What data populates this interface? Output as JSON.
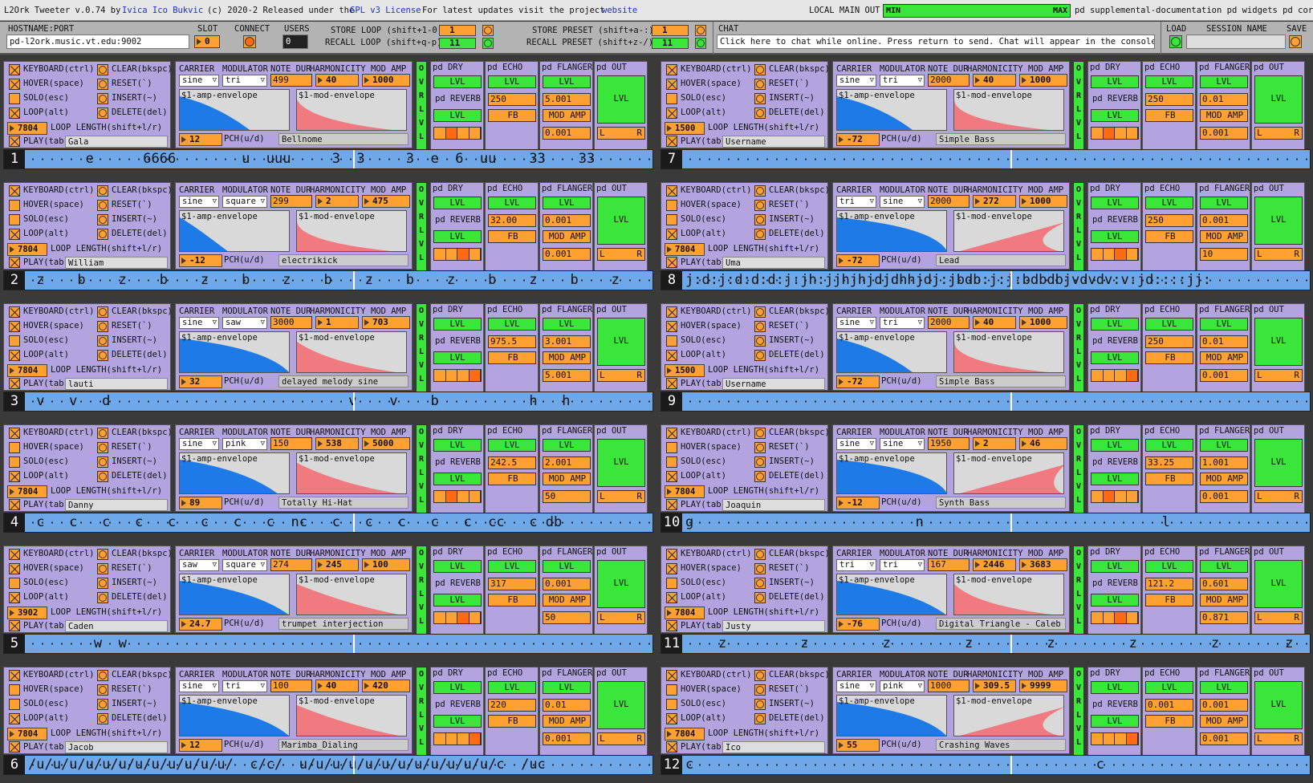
{
  "top": {
    "title": "L2Ork Tweeter v.0.74 by",
    "author": "Ivica Ico Bukvic",
    "released": "(c) 2020-2 Released under the",
    "license": "GPL v3 License",
    "update": "For latest visits the project",
    "update2": "For latest updates visit the project",
    "website": "website",
    "local_main_out": "LOCAL MAIN OUT",
    "meter_min": "MIN",
    "meter_max": "MAX",
    "menu": "pd supplemental-documentation pd widgets pd core"
  },
  "bar": {
    "hostname_label": "HOSTNAME:PORT",
    "hostname_value": "pd-l2ork.music.vt.edu:9002",
    "slot_label": "SLOT",
    "slot_value": "0",
    "connect_label": "CONNECT",
    "users_label": "USERS",
    "users_value": "0",
    "store_loop": "STORE LOOP (shift+1-0)",
    "recall_loop": "RECALL LOOP (shift+q-p)",
    "store_loop_val": "1",
    "recall_loop_val": "11",
    "store_preset": "STORE PRESET (shift+a-:)",
    "recall_preset": "RECALL PRESET (shift+z-/)",
    "store_preset_val": "1",
    "recall_preset_val": "11",
    "chat_label": "CHAT",
    "chat_text": "Click here to chat while online. Press return to send. Chat will appear in the console.",
    "load_label": "LOAD",
    "session_label": "SESSION NAME",
    "save_label": "SAVE"
  },
  "labels": {
    "keyboard": "KEYBOARD(ctrl)",
    "hover": "HOVER(space)",
    "solo": "SOLO(esc)",
    "loop": "LOOP(alt)",
    "play": "PLAY(tab)",
    "clear": "CLEAR(bkspc)",
    "reset": "RESET(`)",
    "insert": "INSERT(~)",
    "delete": "DELETE(del)",
    "loop_length": "LOOP LENGTH(shift+l/r)",
    "carrier": "CARRIER",
    "modulator": "MODULATOR",
    "note_dur": "NOTE DUR",
    "harmonicity": "HARMONICITY",
    "mod_amp": "MOD AMP",
    "pch": "PCH(u/d)",
    "amp_env": "$1-amp-envelope",
    "mod_env": "$1-mod-envelope",
    "pd_dry": "pd DRY",
    "pd_echo": "pd ECHO",
    "pd_flanger": "pd FLANGER",
    "pd_out": "pd OUT",
    "pd_reverb": "pd REVERB",
    "lvl": "LVL",
    "fb": "FB",
    "mod_amp_btn": "MOD AMP",
    "ovr": "O V R L V L",
    "ms": "ms",
    "hz": "Hz",
    "l": "L",
    "r": "R"
  },
  "instruments": [
    {
      "n": "1",
      "user": "Gala",
      "loop_len": "7804",
      "carrier": "sine",
      "mod": "tri",
      "dur": "499",
      "harm": "40",
      "modamp": "1000",
      "pch": "12",
      "name": "Bellnome",
      "echo": "250",
      "flg": "5.001",
      "out": "0.001",
      "pattern": "       e      6666        u  uuu     3  3     3  e  6  uu    33    33         e"
    },
    {
      "n": "2",
      "user": "William",
      "loop_len": "7804",
      "carrier": "sine",
      "mod": "square",
      "dur": "299",
      "harm": "2",
      "modamp": "475",
      "pch": "-12",
      "name": "electrikick",
      "echo": "32.00",
      "flg": "0.001",
      "out": "0.001",
      "pattern": " z    b    z    b    z    b    z    b    z    b    z    b    z    b    z    b"
    },
    {
      "n": "3",
      "user": "lauti",
      "loop_len": "7804",
      "carrier": "sine",
      "mod": "saw",
      "dur": "3000",
      "harm": "1",
      "modamp": "703",
      "pch": "32",
      "name": "delayed melody sine",
      "echo": "975.5",
      "flg": "3.001",
      "out": "5.001",
      "pattern": " v   v   d                             v    v    b           h   h                 j  <"
    },
    {
      "n": "4",
      "user": "Danny",
      "loop_len": "7804",
      "carrier": "sine",
      "mod": "pink",
      "dur": "150",
      "harm": "538",
      "modamp": "5000",
      "pch": "89",
      "name": "Totally Hi-Hat",
      "echo": "242.5",
      "flg": "2.001",
      "out": "50",
      "pattern": " c   c   c   c   c   c   c   c  nc   c   c   c   c   c  cc   c db"
    },
    {
      "n": "5",
      "user": "Caden",
      "loop_len": "3902",
      "carrier": "saw",
      "mod": "square",
      "dur": "274",
      "harm": "245",
      "modamp": "100",
      "pch": "24.7",
      "name": "trumpet interjection",
      "echo": "317",
      "flg": "0.001",
      "out": "50",
      "pattern": "        w  w                                                                      :       :          7b"
    },
    {
      "n": "6",
      "user": "Jacob",
      "loop_len": "7804",
      "carrier": "sine",
      "mod": "tri",
      "dur": "100",
      "harm": "40",
      "modamp": "420",
      "pch": "12",
      "name": "Marimba_Dialing",
      "echo": "220",
      "flg": "0.01",
      "out": "0.001",
      "pattern": "/u/u/u/u/u/u/u/u/u/u/u/u/  c/c/  u/u/u/u/u/u/u/u/u/u/u/u/c  /uc"
    },
    {
      "n": "7",
      "user": "Username",
      "loop_len": "1500",
      "carrier": "sine",
      "mod": "tri",
      "dur": "2000",
      "harm": "40",
      "modamp": "1000",
      "pch": "-72",
      "name": "Simple Bass",
      "echo": "250",
      "flg": "0.01",
      "out": "0.001",
      "pattern": ""
    },
    {
      "n": "8",
      "user": "Uma",
      "loop_len": "7804",
      "carrier": "tri",
      "mod": "sine",
      "dur": "2000",
      "harm": "272",
      "modamp": "1000",
      "pch": "-72",
      "name": "Lead",
      "echo": "250",
      "flg": "0.001",
      "out": "10",
      "pattern": "j:d:j:d:d:d:j:jh:jjhjhjdjdhhjdj:jbdb:j:j:bdbdbjvdvdv:v:jd::::jj:"
    },
    {
      "n": "9",
      "user": "Username",
      "loop_len": "1500",
      "carrier": "sine",
      "mod": "tri",
      "dur": "2000",
      "harm": "40",
      "modamp": "1000",
      "pch": "-72",
      "name": "Simple Bass",
      "echo": "250",
      "flg": "0.01",
      "out": "0.001",
      "pattern": ""
    },
    {
      "n": "10",
      "user": "Joaquin",
      "loop_len": "7804",
      "carrier": "sine",
      "mod": "sine",
      "dur": "1950",
      "harm": "2",
      "modamp": "46",
      "pch": "-12",
      "name": "Synth Bass",
      "echo": "33.25",
      "flg": "1.001",
      "out": "0.001",
      "pattern": "g                           n                             l                     m"
    },
    {
      "n": "11",
      "user": "Justy",
      "loop_len": "7804",
      "carrier": "tri",
      "mod": "tri",
      "dur": "167",
      "harm": "2446",
      "modamp": "3683",
      "pch": "-76",
      "name": "Digital Triangle - Caleb",
      "echo": "121.2",
      "flg": "0.601",
      "out": "0.871",
      "pattern": "    z         z         z         z         z         z         z        z   z"
    },
    {
      "n": "12",
      "user": "Ico",
      "loop_len": "7804",
      "carrier": "sine",
      "mod": "pink",
      "dur": "1000",
      "harm": "309.5",
      "modamp": "9999",
      "pch": "55",
      "name": "Crashing Waves",
      "echo": "0.001",
      "flg": "0.001",
      "out": "0.001",
      "pattern": "c                                                 c"
    }
  ]
}
